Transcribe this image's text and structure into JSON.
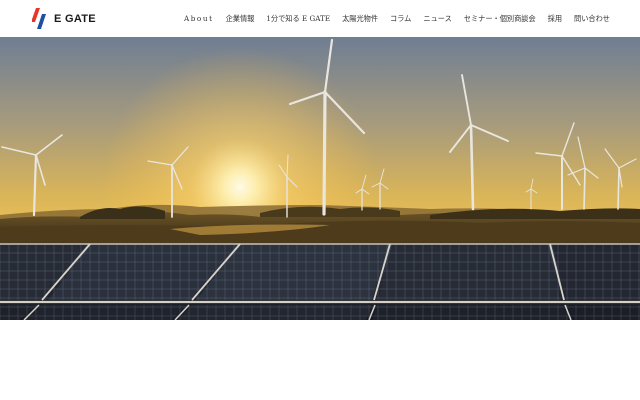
{
  "header": {
    "logo_text": "E GATE",
    "logo_colors": [
      "#e8342a",
      "#1e4fa3"
    ],
    "nav": [
      {
        "label": "About",
        "name": "nav-about"
      },
      {
        "label": "企業情報",
        "name": "nav-company-info"
      },
      {
        "label": "1分で知る E GATE",
        "name": "nav-egate-in-1-minute"
      },
      {
        "label": "太陽光物件",
        "name": "nav-solar-properties"
      },
      {
        "label": "コラム",
        "name": "nav-column"
      },
      {
        "label": "ニュース",
        "name": "nav-news"
      },
      {
        "label": "セミナー・個別商談会",
        "name": "nav-seminar"
      },
      {
        "label": "採用",
        "name": "nav-recruit"
      },
      {
        "label": "問い合わせ",
        "name": "nav-contact"
      }
    ]
  },
  "hero": {
    "image": "wind-turbines-and-solar-panels-at-sunset"
  }
}
